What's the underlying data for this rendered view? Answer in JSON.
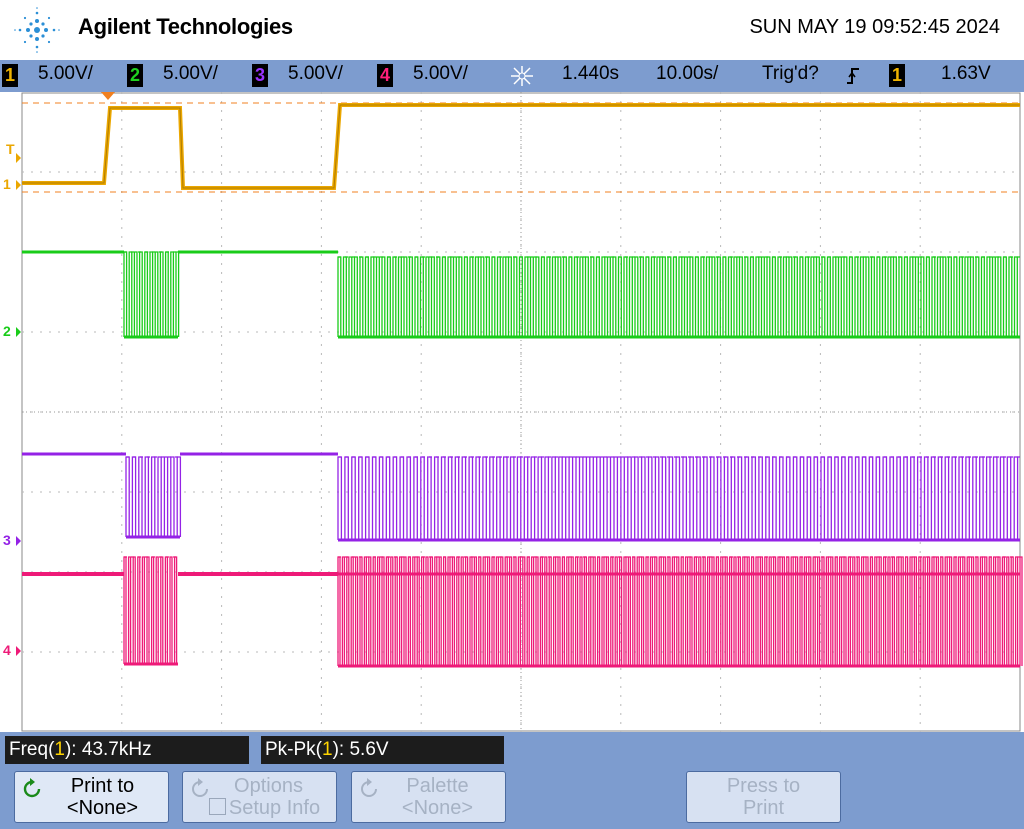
{
  "header": {
    "brand": "Agilent Technologies",
    "datetime": "SUN MAY 19 09:52:45 2024"
  },
  "statusbar": {
    "channels": [
      {
        "num": "1",
        "scale": "5.00V/",
        "color": "#f0b400"
      },
      {
        "num": "2",
        "scale": "5.00V/",
        "color": "#1fd11f"
      },
      {
        "num": "3",
        "scale": "5.00V/",
        "color": "#9933ff"
      },
      {
        "num": "4",
        "scale": "5.00V/",
        "color": "#ff1f7a"
      }
    ],
    "delay": "1.440s",
    "timebase": "10.00s/",
    "trigger_status": "Trig'd?",
    "trigger_source": "1",
    "trigger_level": "1.63V"
  },
  "display": {
    "trigger_marker": "T",
    "ground_markers": [
      "1",
      "2",
      "3",
      "4"
    ],
    "colors": {
      "ch1": "#eba700",
      "ch2": "#19cc19",
      "ch3": "#9422e6",
      "ch4": "#ee1a78",
      "grid": "#b9b9b9",
      "trigger_line": "#f08020"
    }
  },
  "measurements": {
    "freq": {
      "label_pre": "Freq(",
      "source": "1",
      "label_post": "): ",
      "value": "43.7kHz"
    },
    "pkpk": {
      "label_pre": "Pk-Pk(",
      "source": "1",
      "label_post": "): ",
      "value": "5.6V"
    }
  },
  "softkeys": [
    {
      "line1": "Print to",
      "line2": "<None>",
      "enabled": true,
      "icon": "rotate-icon"
    },
    {
      "line1": "Options",
      "line2": "Setup Info",
      "enabled": false,
      "icon": "rotate-icon"
    },
    {
      "line1": "Palette",
      "line2": "<None>",
      "enabled": false,
      "icon": "rotate-icon"
    },
    {
      "line1": "Press to",
      "line2": "Print",
      "enabled": false,
      "icon": ""
    }
  ]
}
